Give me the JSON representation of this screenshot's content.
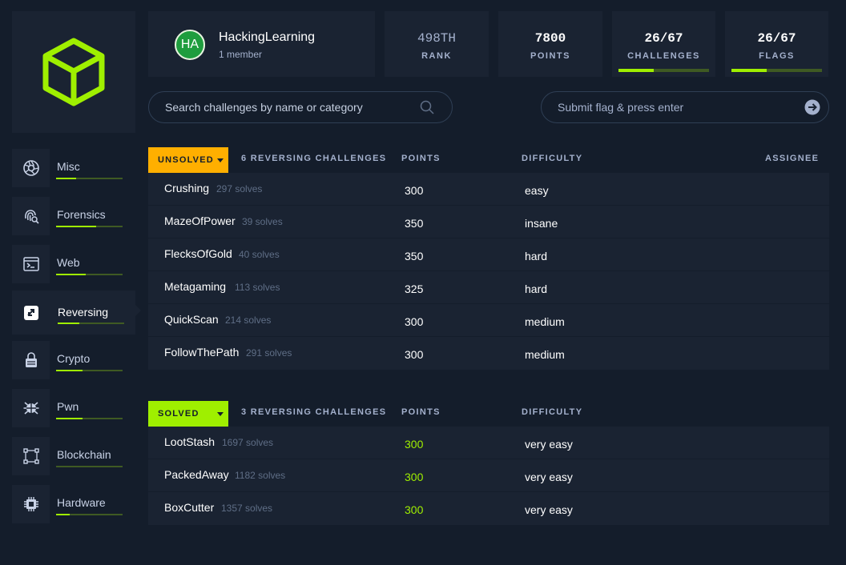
{
  "team": {
    "avatar_initials": "HA",
    "name": "HackingLearning",
    "members": "1 member"
  },
  "stats": [
    {
      "value": "498TH",
      "label": "RANK"
    },
    {
      "value": "7800",
      "label": "POINTS"
    },
    {
      "value": "26/67",
      "label": "CHALLENGES",
      "progress": 0.39
    },
    {
      "value": "26/67",
      "label": "FLAGS",
      "progress": 0.39
    }
  ],
  "search": {
    "placeholder": "Search challenges by name or category"
  },
  "flag": {
    "placeholder": "Submit flag & press enter"
  },
  "sidebar": {
    "items": [
      {
        "label": "Misc",
        "icon": "camera-shutter-icon",
        "progress": 0.3
      },
      {
        "label": "Forensics",
        "icon": "fingerprint-search-icon",
        "progress": 0.6
      },
      {
        "label": "Web",
        "icon": "terminal-window-icon",
        "progress": 0.45
      },
      {
        "label": "Reversing",
        "icon": "reverse-arrows-icon",
        "progress": 0.33,
        "active": true
      },
      {
        "label": "Crypto",
        "icon": "lock-icon",
        "progress": 0.4
      },
      {
        "label": "Pwn",
        "icon": "bug-icon",
        "progress": 0.4
      },
      {
        "label": "Blockchain",
        "icon": "nodes-square-icon",
        "progress": 0.0
      },
      {
        "label": "Hardware",
        "icon": "chip-icon",
        "progress": 0.2
      }
    ]
  },
  "unsolved": {
    "tag": "UNSOLVED",
    "count_label": "6 REVERSING CHALLENGES",
    "col_points": "POINTS",
    "col_difficulty": "DIFFICULTY",
    "col_assignee": "ASSIGNEE",
    "rows": [
      {
        "name": "Crushing",
        "solves": "297 solves",
        "points": "300",
        "difficulty": "easy"
      },
      {
        "name": "MazeOfPower",
        "solves": "39 solves",
        "points": "350",
        "difficulty": "insane"
      },
      {
        "name": "FlecksOfGold",
        "solves": "40 solves",
        "points": "350",
        "difficulty": "hard"
      },
      {
        "name": "Metagaming",
        "solves": "113 solves",
        "points": "325",
        "difficulty": "hard"
      },
      {
        "name": "QuickScan",
        "solves": "214 solves",
        "points": "300",
        "difficulty": "medium"
      },
      {
        "name": "FollowThePath",
        "solves": "291 solves",
        "points": "300",
        "difficulty": "medium"
      }
    ]
  },
  "solved": {
    "tag": "SOLVED",
    "count_label": "3 REVERSING CHALLENGES",
    "col_points": "POINTS",
    "col_difficulty": "DIFFICULTY",
    "rows": [
      {
        "name": "LootStash",
        "solves": "1697 solves",
        "points": "300",
        "difficulty": "very easy"
      },
      {
        "name": "PackedAway",
        "solves": "1182 solves",
        "points": "300",
        "difficulty": "very easy"
      },
      {
        "name": "BoxCutter",
        "solves": "1357 solves",
        "points": "300",
        "difficulty": "very easy"
      }
    ]
  },
  "colors": {
    "bg": "#141d2b",
    "panel": "#1a2332",
    "accent_green": "#9fef00",
    "accent_orange": "#ffaf00",
    "muted": "#a4b1cd"
  }
}
